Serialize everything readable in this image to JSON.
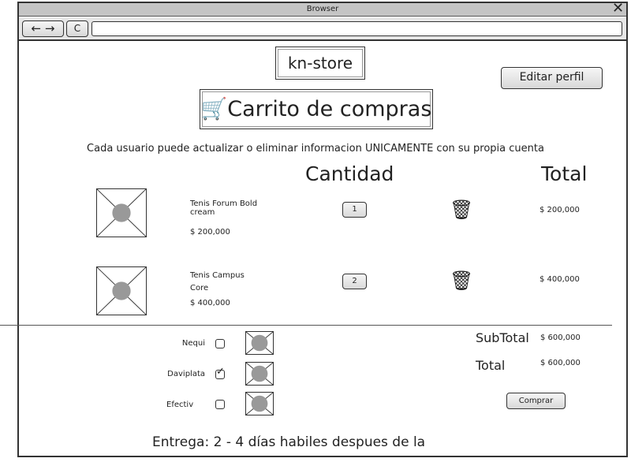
{
  "browser": {
    "title": "Browser",
    "url": "",
    "back": "←",
    "forward": "→",
    "refresh": "C"
  },
  "header": {
    "store": "kn-store",
    "edit_profile": "Editar perfil",
    "cart_title": "Carrito de compras",
    "notice": "Cada usuario puede actualizar o eliminar informacion UNICAMENTE con su propia cuenta"
  },
  "columns": {
    "quantity": "Cantidad",
    "total": "Total"
  },
  "items": [
    {
      "name": "Tenis Forum Bold cream",
      "price": "$ 200,000",
      "quantity": "1",
      "total": "$ 200,000"
    },
    {
      "name": "Tenis Campus Core",
      "price": "$ 400,000",
      "quantity": "2",
      "total": "$ 400,000"
    }
  ],
  "payment": [
    {
      "label": "Nequi",
      "checked": false
    },
    {
      "label": "Daviplata",
      "checked": true
    },
    {
      "label": "Efectiv",
      "checked": false
    }
  ],
  "summary": {
    "subtotal_label": "SubTotal",
    "subtotal": "$ 600,000",
    "total_label": "Total",
    "total": "$ 600,000",
    "buy": "Comprar"
  },
  "delivery": "Entrega: 2 - 4 días habiles despues de la"
}
